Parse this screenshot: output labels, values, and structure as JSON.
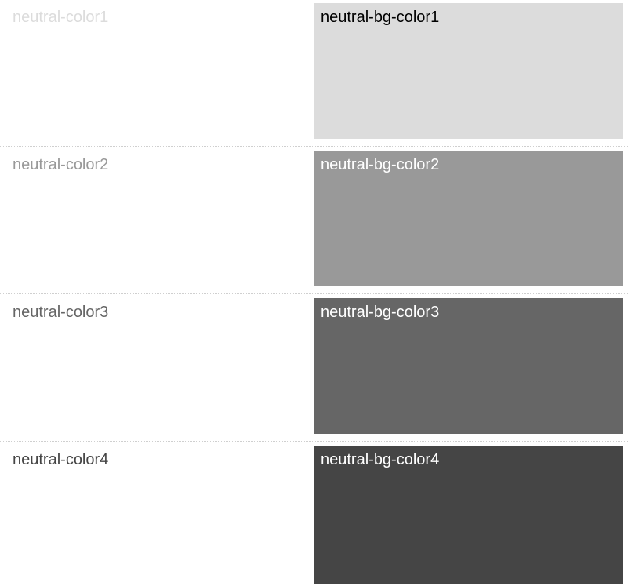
{
  "swatches": [
    {
      "text_label": "neutral-color1",
      "bg_label": "neutral-bg-color1",
      "text_color": "#dcdcdc",
      "bg_color": "#dcdcdc",
      "bg_text_color": "#000000"
    },
    {
      "text_label": "neutral-color2",
      "bg_label": "neutral-bg-color2",
      "text_color": "#999999",
      "bg_color": "#999999",
      "bg_text_color": "#ffffff"
    },
    {
      "text_label": "neutral-color3",
      "bg_label": "neutral-bg-color3",
      "text_color": "#666666",
      "bg_color": "#666666",
      "bg_text_color": "#ffffff"
    },
    {
      "text_label": "neutral-color4",
      "bg_label": "neutral-bg-color4",
      "text_color": "#454545",
      "bg_color": "#454545",
      "bg_text_color": "#ffffff"
    }
  ]
}
